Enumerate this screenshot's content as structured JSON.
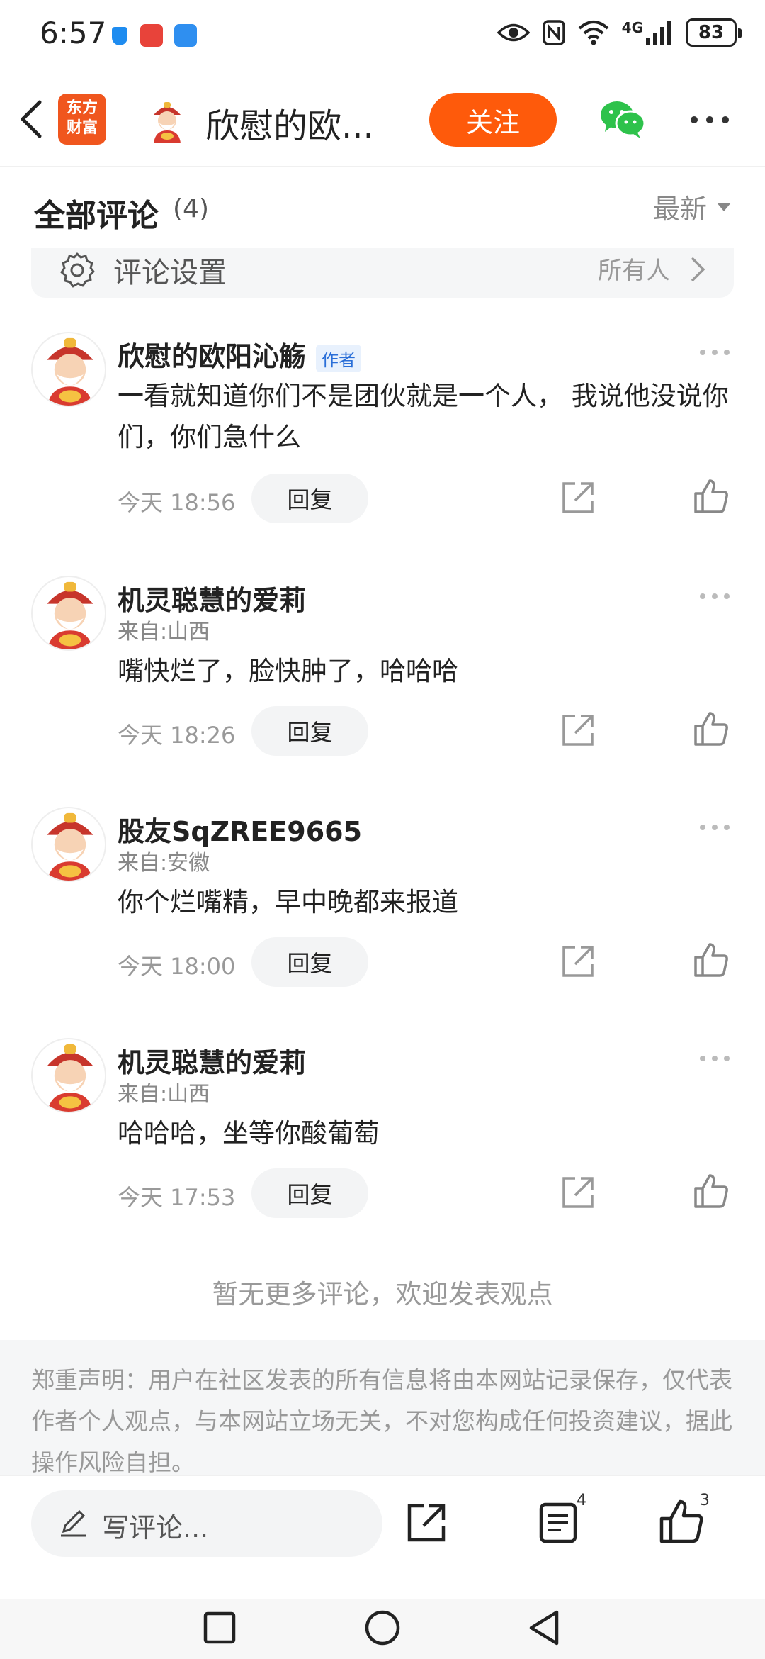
{
  "status": {
    "time": "6:57",
    "network": "4G",
    "battery": "83"
  },
  "nav": {
    "logo_line1": "东方",
    "logo_line2": "财富",
    "title": "欣慰的欧...",
    "follow_label": "关注"
  },
  "comments_header": {
    "title": "全部评论",
    "count": "(4)",
    "sort_label": "最新"
  },
  "settings": {
    "label": "评论设置",
    "value": "所有人"
  },
  "comments": [
    {
      "user": "欣慰的欧阳沁觞",
      "badge": "作者",
      "location": "",
      "text": "一看就知道你们不是团伙就是一个人， 我说他没说你们，你们急什么",
      "time": "今天 18:56",
      "reply_label": "回复"
    },
    {
      "user": "机灵聪慧的爱莉",
      "badge": "",
      "location": "来自:山西",
      "text": "嘴快烂了，脸快肿了，哈哈哈",
      "time": "今天 18:26",
      "reply_label": "回复"
    },
    {
      "user": "股友SqZREE9665",
      "badge": "",
      "location": "来自:安徽",
      "text": "你个烂嘴精，早中晚都来报道",
      "time": "今天 18:00",
      "reply_label": "回复"
    },
    {
      "user": "机灵聪慧的爱莉",
      "badge": "",
      "location": "来自:山西",
      "text": "哈哈哈，坐等你酸葡萄",
      "time": "今天 17:53",
      "reply_label": "回复"
    }
  ],
  "no_more": "暂无更多评论，欢迎发表观点",
  "disclaimer": "郑重声明：用户在社区发表的所有信息将由本网站记录保存，仅代表作者个人观点，与本网站立场无关，不对您构成任何投资建议，据此操作风险自担。",
  "bottom": {
    "write_placeholder": "写评论...",
    "list_count": "4",
    "like_count": "3"
  },
  "colors": {
    "accent": "#fe5a0b",
    "logo": "#f0561e",
    "author_badge": "#2b6fd8"
  }
}
